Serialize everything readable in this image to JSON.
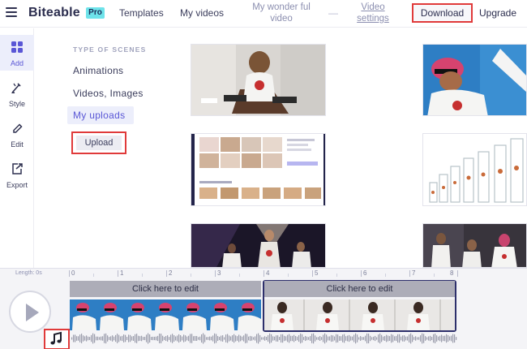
{
  "header": {
    "brand": "Biteable",
    "badge": "Pro",
    "nav": [
      "Templates",
      "My videos"
    ],
    "project_title": "My wonder ful video",
    "separator": "—",
    "video_settings": "Video settings",
    "download": "Download",
    "upgrade": "Upgrade"
  },
  "sidebar": {
    "items": [
      {
        "label": "Add",
        "icon": "grid-icon"
      },
      {
        "label": "Style",
        "icon": "brush-icon"
      },
      {
        "label": "Edit",
        "icon": "pencil-icon"
      },
      {
        "label": "Export",
        "icon": "export-icon"
      }
    ]
  },
  "scenes": {
    "heading": "TYPE OF SCENES",
    "links": [
      "Animations",
      "Videos, Images",
      "My uploads"
    ],
    "upload": "Upload"
  },
  "thumbnails": [
    {
      "name": "man-sitting-on-chair"
    },
    {
      "name": "dancer-in-sunglasses"
    },
    {
      "name": "template-page-screenshot"
    },
    {
      "name": "test-tubes-row"
    },
    {
      "name": "stage-performers"
    },
    {
      "name": "dancers-group"
    }
  ],
  "timeline": {
    "length_label": "Length: 0s",
    "ruler": [
      "0",
      "1",
      "2",
      "3",
      "4",
      "5",
      "6",
      "7",
      "8"
    ],
    "clip1_label": "Click here to edit",
    "clip2_label": "Click here to edit"
  },
  "colors": {
    "accent": "#5a57d6",
    "highlight_border": "#e03a3a",
    "pro_badge": "#6ee3ea"
  }
}
